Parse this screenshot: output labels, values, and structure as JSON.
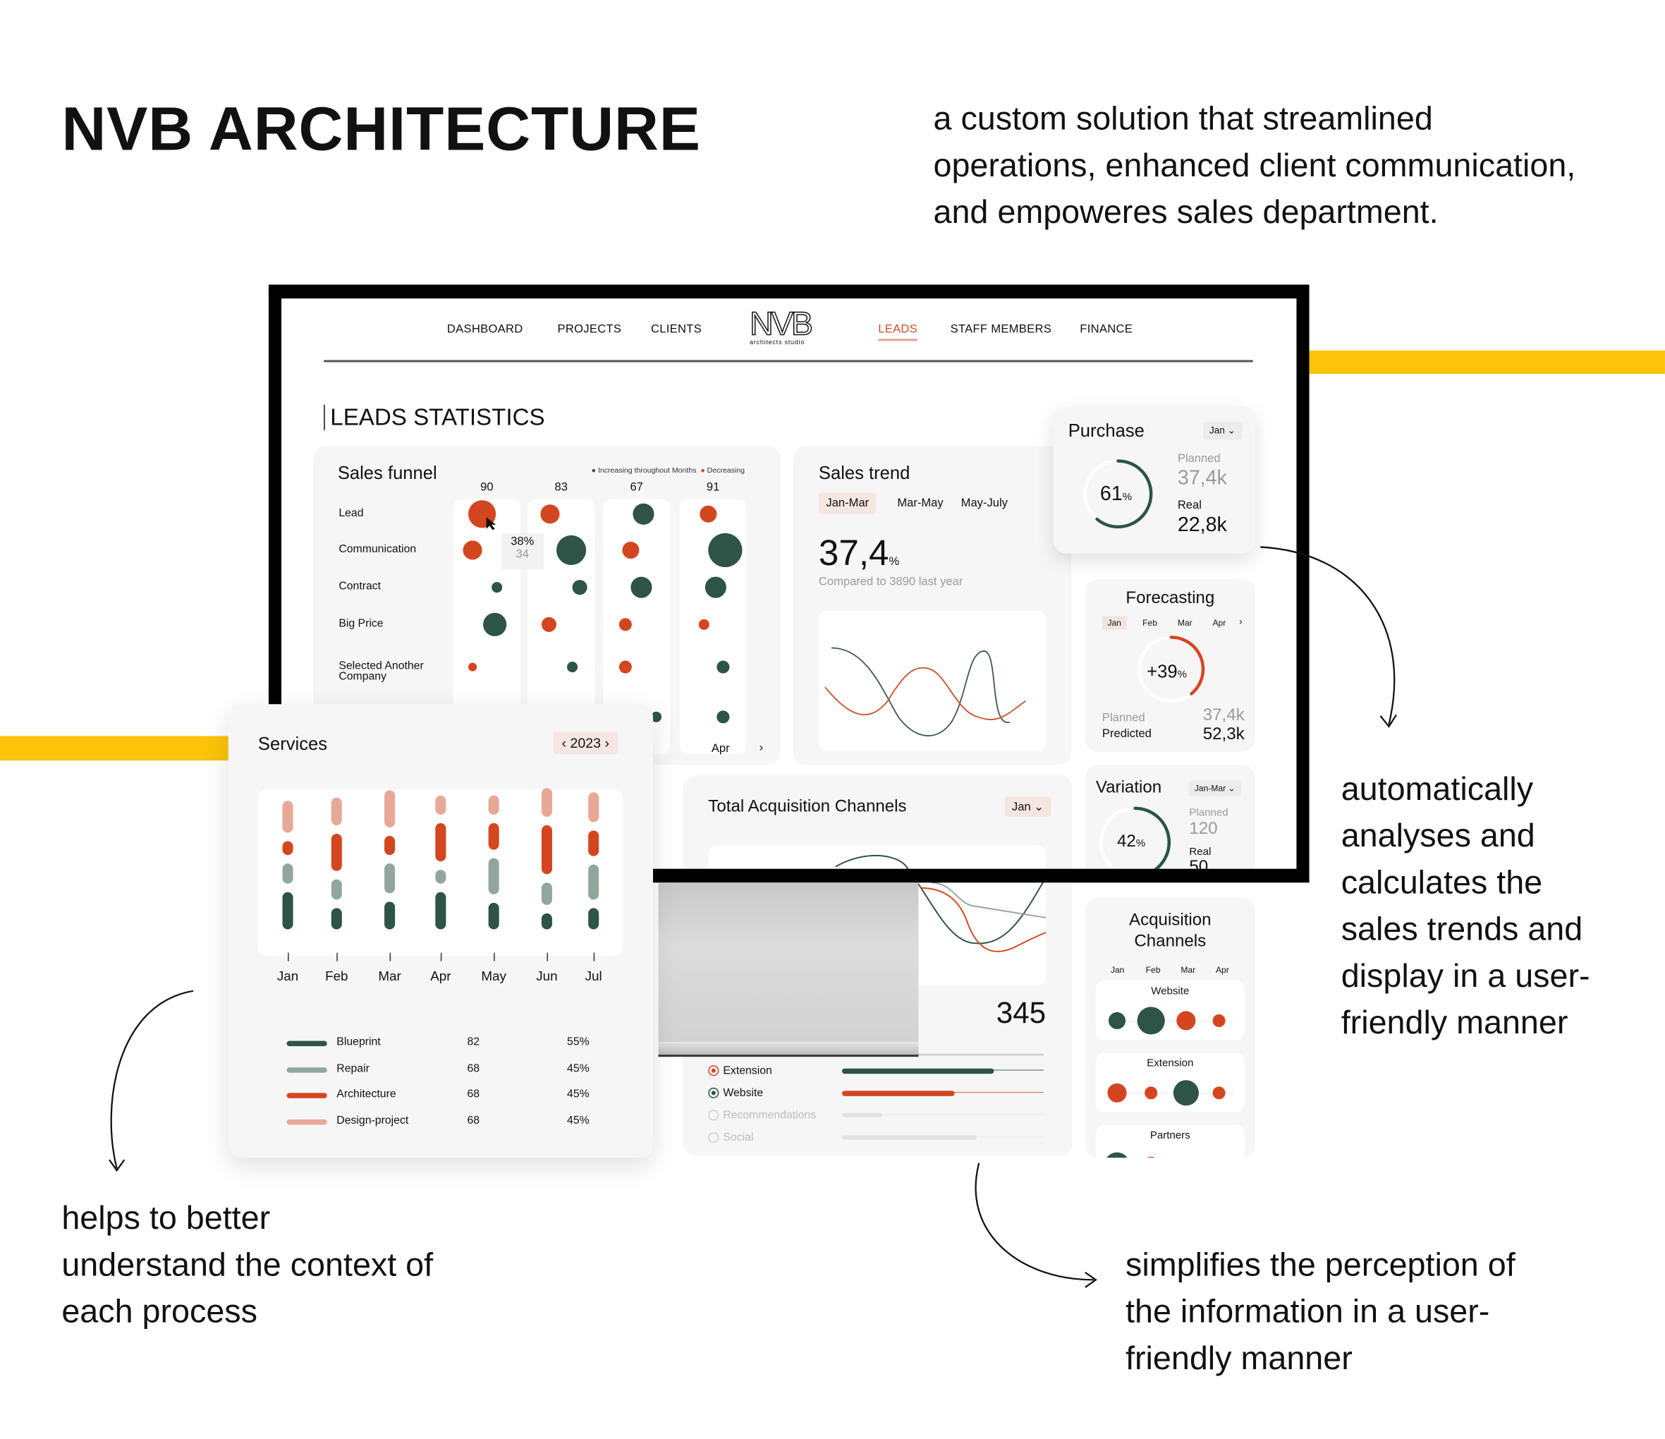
{
  "header": {
    "title": "NVB ARCHITECTURE",
    "tagline": [
      "a custom solution that streamlined",
      "operations, enhanced client communication,",
      "and empoweres sales department."
    ]
  },
  "colors": {
    "green": "#2d5446",
    "orange": "#d4461f",
    "gray": "#93a69e",
    "pink": "#e8a898",
    "yellow": "#fcc30b",
    "card": "#f6f6f6"
  },
  "nav": {
    "items": [
      "DASHBOARD",
      "PROJECTS",
      "CLIENTS",
      "LEADS",
      "STAFF MEMBERS",
      "FINANCE"
    ],
    "active": "LEADS",
    "logo": {
      "text": "NVB",
      "sub": "architects studio"
    }
  },
  "page_title": "LEADS STATISTICS",
  "sales_funnel": {
    "title": "Sales funnel",
    "legend": [
      "Increasing throughout Months",
      "Decreasing"
    ],
    "rows": [
      "Lead",
      "Communication",
      "Contract",
      "Big Price",
      "Selected Another Company"
    ],
    "columns": [
      {
        "total": "90",
        "bubbles": [
          {
            "t": "dec",
            "size": 13
          },
          {
            "t": "dec",
            "size": 9
          },
          {
            "t": "inc",
            "size": 5
          },
          {
            "t": "inc",
            "size": 11
          },
          {
            "t": "dec",
            "size": 4
          }
        ]
      },
      {
        "total": "83",
        "bubbles": [
          {
            "t": "dec",
            "size": 9
          },
          {
            "t": "inc",
            "size": 14
          },
          {
            "t": "inc",
            "size": 7
          },
          {
            "t": "dec",
            "size": 7
          },
          {
            "t": "inc",
            "size": 5
          }
        ]
      },
      {
        "total": "67",
        "bubbles": [
          {
            "t": "inc",
            "size": 10
          },
          {
            "t": "dec",
            "size": 8
          },
          {
            "t": "inc",
            "size": 10
          },
          {
            "t": "dec",
            "size": 6
          },
          {
            "t": "dec",
            "size": 6
          },
          {
            "t": "inc",
            "size": 5
          }
        ]
      },
      {
        "total": "91",
        "bubbles": [
          {
            "t": "dec",
            "size": 8
          },
          {
            "t": "inc",
            "size": 16
          },
          {
            "t": "inc",
            "size": 10
          },
          {
            "t": "dec",
            "size": 5
          },
          {
            "t": "inc",
            "size": 6
          },
          {
            "t": "inc",
            "size": 6
          }
        ]
      }
    ],
    "tooltip": {
      "percent": "38%",
      "value": "34"
    },
    "footer_month": "Apr",
    "next": "›"
  },
  "sales_trend": {
    "title": "Sales trend",
    "tabs": [
      "Jan-Mar",
      "Mar-May",
      "May-July"
    ],
    "active_tab": "Jan-Mar",
    "value": "37,4",
    "unit": "%",
    "compare": "Compared to 3890 last year"
  },
  "purchase": {
    "title": "Purchase",
    "dropdown": "Jan",
    "percent": 61,
    "percent_label": "61",
    "unit": "%",
    "planned_label": "Planned",
    "planned": "37,4k",
    "real_label": "Real",
    "real": "22,8k"
  },
  "forecasting": {
    "title": "Forecasting",
    "months": [
      "Jan",
      "Feb",
      "Mar",
      "Apr"
    ],
    "active": "Jan",
    "percent": 39,
    "percent_label": "+39",
    "unit": "%",
    "planned_label": "Planned",
    "planned": "37,4k",
    "predicted_label": "Predicted",
    "predicted": "52,3k"
  },
  "variation": {
    "title": "Variation",
    "dropdown": "Jan-Mar",
    "percent": 42,
    "percent_label": "42",
    "unit": "%",
    "planned_label": "Planned",
    "planned": "120",
    "real_label": "Real",
    "real": "50"
  },
  "total_acquisition": {
    "title": "Total Acquisition Channels",
    "dropdown": "Jan",
    "total": "345",
    "channels": [
      {
        "name": "Extension",
        "selected": true,
        "color": "#d4461f",
        "bar_color": "#2d5446",
        "value": 0.75
      },
      {
        "name": "Website",
        "selected": true,
        "color": "#2d5446",
        "bar_color": "#d4461f",
        "value": 0.56
      },
      {
        "name": "Recommendations",
        "selected": false,
        "color": "#cfcfcf",
        "bar_color": "#e2e2e2",
        "value": 0.2
      },
      {
        "name": "Social",
        "selected": false,
        "color": "#cfcfcf",
        "bar_color": "#e2e2e2",
        "value": 0.67
      }
    ]
  },
  "acquisition_channels": {
    "title": [
      "Acquisition",
      "Channels"
    ],
    "months": [
      "Jan",
      "Feb",
      "Mar",
      "Apr"
    ],
    "rows": [
      {
        "name": "Website",
        "bubbles": [
          {
            "t": "inc",
            "size": 8
          },
          {
            "t": "inc",
            "size": 13
          },
          {
            "t": "dec",
            "size": 9
          },
          {
            "t": "dec",
            "size": 6
          }
        ]
      },
      {
        "name": "Extension",
        "bubbles": [
          {
            "t": "dec",
            "size": 9
          },
          {
            "t": "dec",
            "size": 6
          },
          {
            "t": "inc",
            "size": 12
          },
          {
            "t": "dec",
            "size": 6
          }
        ]
      },
      {
        "name": "Partners",
        "bubbles": [
          {
            "t": "inc",
            "size": 12
          },
          {
            "t": "dec",
            "size": 8
          }
        ]
      }
    ]
  },
  "services": {
    "title": "Services",
    "year": "2023",
    "prev": "‹",
    "next": "›",
    "months": [
      "Jan",
      "Feb",
      "Mar",
      "Apr",
      "May",
      "Jun",
      "Jul"
    ],
    "stack": [
      [
        110,
        65,
        45,
        95
      ],
      [
        65,
        65,
        110,
        85
      ],
      [
        85,
        90,
        60,
        110
      ],
      [
        110,
        45,
        115,
        60
      ],
      [
        80,
        110,
        80,
        60
      ],
      [
        50,
        70,
        145,
        85
      ],
      [
        65,
        105,
        80,
        90
      ]
    ],
    "legend": [
      {
        "name": "Blueprint",
        "value": "82",
        "pct": "55%",
        "color": "#2d5446"
      },
      {
        "name": "Repair",
        "value": "68",
        "pct": "45%",
        "color": "#93a69e"
      },
      {
        "name": "Architecture",
        "value": "68",
        "pct": "45%",
        "color": "#d4461f"
      },
      {
        "name": "Design-project",
        "value": "68",
        "pct": "45%",
        "color": "#e8a898"
      }
    ]
  },
  "annotations": {
    "right": [
      "automatically",
      "analyses and",
      "calculates the",
      "sales trends and",
      "display in a user-",
      "friendly manner"
    ],
    "left": [
      "helps to better",
      "understand the context of",
      "each process"
    ],
    "bottom": [
      "simplifies the perception of",
      "the information in a user-",
      "friendly manner"
    ]
  }
}
